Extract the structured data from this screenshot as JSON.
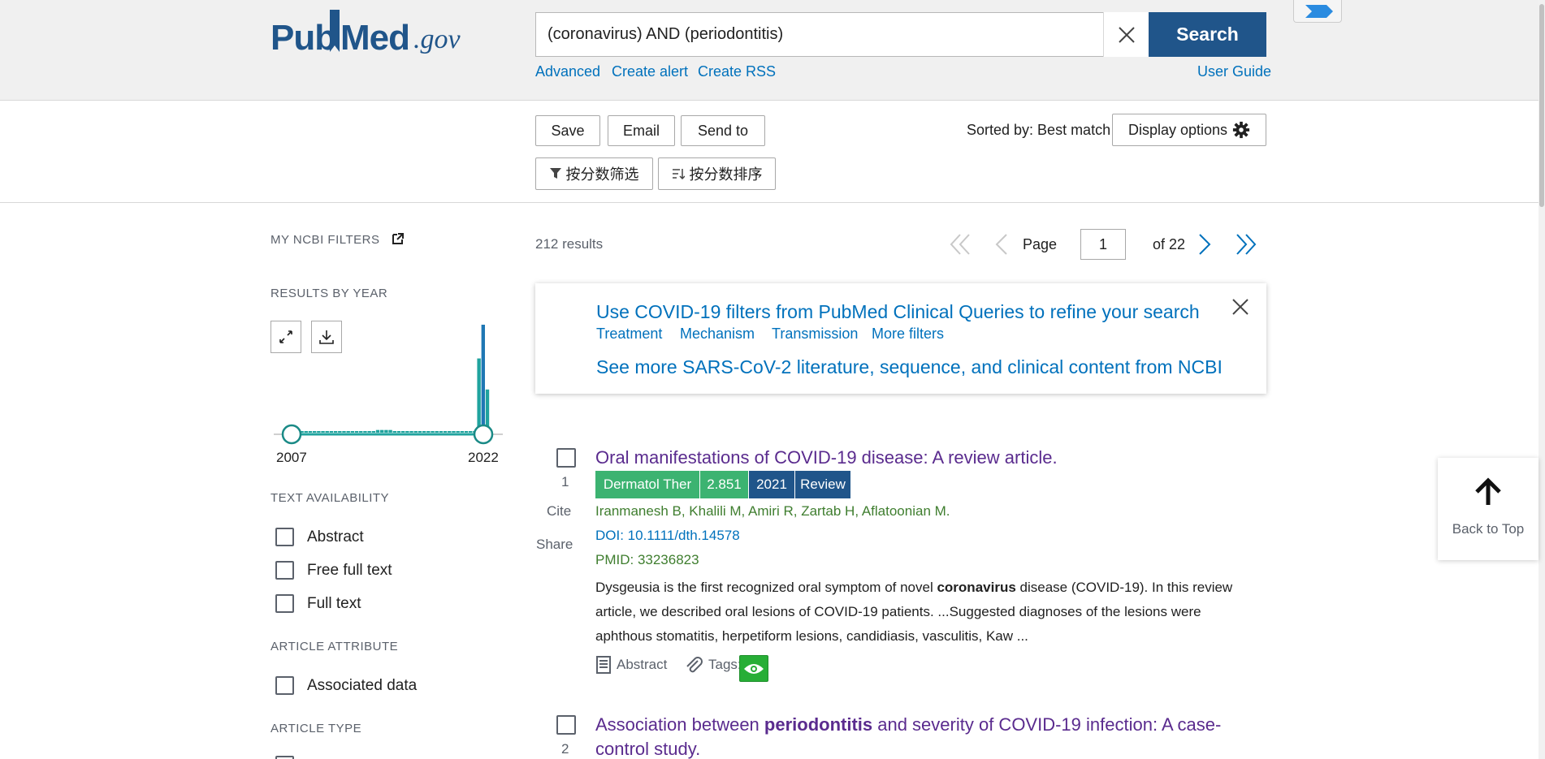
{
  "header": {
    "logo": {
      "part1": "Pub",
      "part2": "Med",
      "part3": ".gov"
    },
    "search": {
      "value": "(coronavirus) AND (periodontitis)",
      "button_label": "Search"
    },
    "links": {
      "advanced": "Advanced",
      "create_alert": "Create alert",
      "create_rss": "Create RSS",
      "user_guide": "User Guide"
    }
  },
  "actions": {
    "save": "Save",
    "email": "Email",
    "send_to": "Send to",
    "sorted_by": "Sorted by: Best match",
    "display_options": "Display options",
    "filter_by_score": "按分数筛选",
    "sort_by_score": "按分数排序"
  },
  "sidebar": {
    "my_ncbi_filters": "MY NCBI FILTERS",
    "results_by_year": "RESULTS BY YEAR",
    "year_start": "2007",
    "year_end": "2022",
    "year_counts": [
      1,
      1,
      1,
      1,
      1,
      1,
      1,
      1,
      1,
      1,
      1,
      1,
      1,
      1,
      1,
      1,
      1,
      1,
      1,
      1,
      2,
      2,
      2,
      2,
      1,
      1,
      1,
      1,
      1,
      1,
      1,
      1,
      1,
      1,
      1,
      1,
      1,
      1,
      1,
      1,
      1,
      1,
      1,
      1,
      55,
      80,
      32
    ],
    "text_availability": "TEXT AVAILABILITY",
    "text_options": [
      "Abstract",
      "Free full text",
      "Full text"
    ],
    "article_attribute": "ARTICLE ATTRIBUTE",
    "attribute_options": [
      "Associated data"
    ],
    "article_type": "ARTICLE TYPE"
  },
  "results": {
    "count": "212 results",
    "page_label": "Page",
    "page_value": "1",
    "of_pages": "of 22"
  },
  "banner": {
    "title": "Use COVID-19 filters from PubMed Clinical Queries to refine your search",
    "links": [
      "Treatment",
      "Mechanism",
      "Transmission",
      "More filters"
    ],
    "more": "See more SARS-CoV-2 literature, sequence, and clinical content from NCBI"
  },
  "articles": [
    {
      "number": "1",
      "cite": "Cite",
      "share": "Share",
      "title": "Oral manifestations of COVID-19 disease: A review article.",
      "badges": {
        "journal": "Dermatol Ther",
        "impact": "2.851",
        "year": "2021",
        "type": "Review"
      },
      "authors": "Iranmanesh B, Khalili M, Amiri R, Zartab H, Aflatoonian M.",
      "doi": "DOI: 10.1111/dth.14578",
      "pmid": "PMID: 33236823",
      "snippet_1": "Dysgeusia is the first recognized oral symptom of novel ",
      "snippet_bold": "coronavirus",
      "snippet_2": " disease (COVID-19). In this review article, we described oral lesions of COVID-19 patients. ...Suggested diagnoses of the lesions were aphthous stomatitis, herpetiform lesions, candidiasis, vasculitis, Kaw ...",
      "abstract_label": "Abstract",
      "tags_label": "Tags:"
    },
    {
      "number": "2",
      "title_1": "Association between ",
      "title_bold": "periodontitis",
      "title_2": " and severity of COVID-19 infection: A case-",
      "title_3": "control study."
    }
  ],
  "back_to_top": "Back to Top",
  "colors": {
    "brand": "#20558a",
    "link": "#0071bc",
    "visited": "#5a2b8e",
    "green_badge": "#3cb371",
    "chart_teal": "#20a39e",
    "chart_blue": "#1f77b4"
  }
}
